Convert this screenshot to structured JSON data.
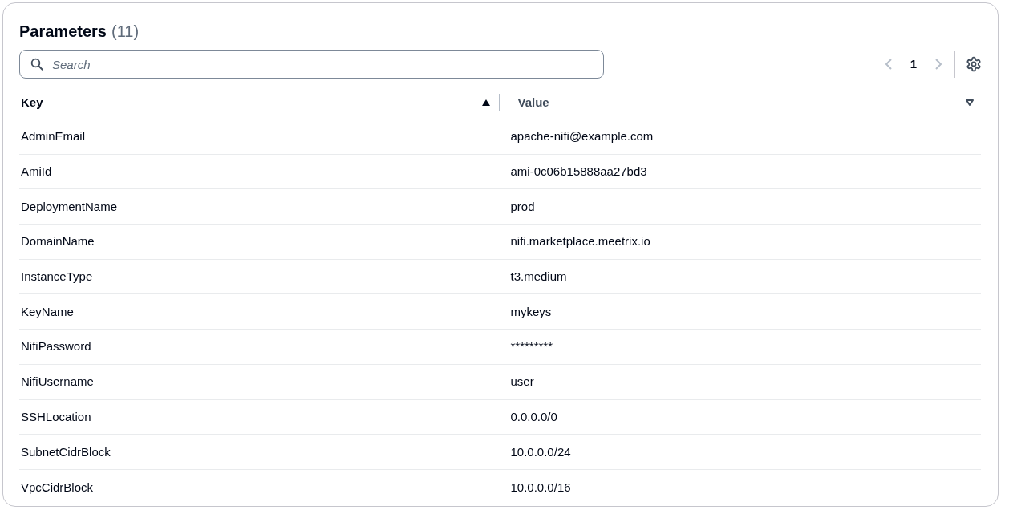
{
  "header": {
    "title": "Parameters",
    "count": "(11)"
  },
  "search": {
    "placeholder": "Search"
  },
  "pagination": {
    "page": "1",
    "prev_disabled": true,
    "next_disabled": true
  },
  "table": {
    "columns": [
      {
        "label": "Key",
        "sorted": true
      },
      {
        "label": "Value",
        "sorted": false
      }
    ],
    "rows": [
      {
        "key": "AdminEmail",
        "value": "apache-nifi@example.com"
      },
      {
        "key": "AmiId",
        "value": "ami-0c06b15888aa27bd3"
      },
      {
        "key": "DeploymentName",
        "value": "prod"
      },
      {
        "key": "DomainName",
        "value": "nifi.marketplace.meetrix.io"
      },
      {
        "key": "InstanceType",
        "value": "t3.medium"
      },
      {
        "key": "KeyName",
        "value": "mykeys"
      },
      {
        "key": "NifiPassword",
        "value": "*********"
      },
      {
        "key": "NifiUsername",
        "value": "user"
      },
      {
        "key": "SSHLocation",
        "value": "0.0.0.0/0"
      },
      {
        "key": "SubnetCidrBlock",
        "value": "10.0.0.0/24"
      },
      {
        "key": "VpcCidrBlock",
        "value": "10.0.0.0/16"
      }
    ]
  }
}
